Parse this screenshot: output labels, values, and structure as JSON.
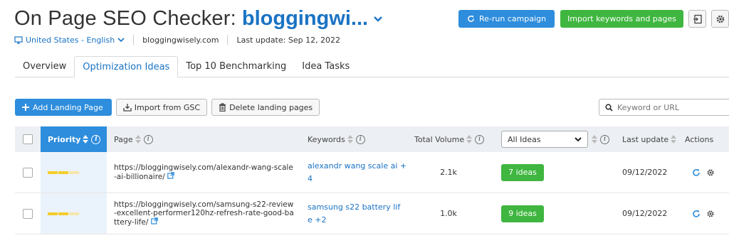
{
  "header": {
    "title": "On Page SEO Checker:",
    "campaign": "bloggingwi...",
    "location": "United States - English",
    "domain": "bloggingwisely.com",
    "last_update": "Last update: Sep 12, 2022",
    "rerun_label": "Re-run campaign",
    "import_label": "Import keywords and pages"
  },
  "tabs": [
    {
      "label": "Overview"
    },
    {
      "label": "Optimization Ideas"
    },
    {
      "label": "Top 10 Benchmarking"
    },
    {
      "label": "Idea Tasks"
    }
  ],
  "toolbar": {
    "add_label": "Add Landing Page",
    "import_gsc_label": "Import from GSC",
    "delete_label": "Delete landing pages",
    "search_placeholder": "Keyword or URL"
  },
  "table": {
    "headers": {
      "priority": "Priority",
      "page": "Page",
      "keywords": "Keywords",
      "volume": "Total Volume",
      "ideas_filter": "All Ideas",
      "last_update": "Last update",
      "actions": "Actions"
    },
    "rows": [
      {
        "url_line1": "https://bloggingwisely.com/alexandr-wang-scale",
        "url_line2": "-ai-billionaire/",
        "url_line3": "",
        "keyword_line1": "alexandr wang scale ai +",
        "keyword_line2": "4",
        "volume": "2.1k",
        "ideas": "7 ideas",
        "last_update": "09/12/2022"
      },
      {
        "url_line1": "https://bloggingwisely.com/samsung-s22-review",
        "url_line2": "-excellent-performer120hz-refresh-rate-good-ba",
        "url_line3": "ttery-life/",
        "keyword_line1": "samsung s22 battery lif",
        "keyword_line2": "e +2",
        "volume": "1.0k",
        "ideas": "9 ideas",
        "last_update": "09/12/2022"
      }
    ]
  },
  "colors": {
    "accent_blue": "#2e8ddc",
    "green": "#3fb63f",
    "priority_yellow": "#f5cd2b"
  }
}
